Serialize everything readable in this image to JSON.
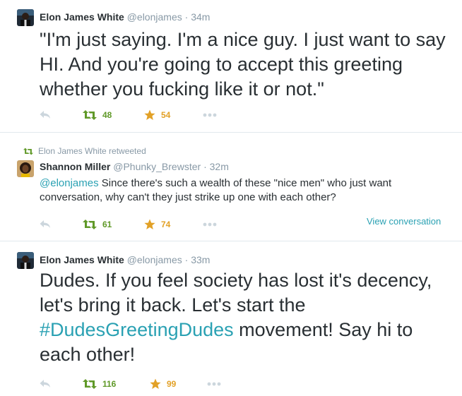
{
  "tweets": [
    {
      "name": "Elon James White",
      "handle": "@elonjames",
      "separator": "·",
      "time": "34m",
      "text": "\"I'm just saying. I'm a nice guy. I just want to say HI. And you're going to accept this greeting whether you fucking like it or not.\"",
      "retweets": "48",
      "favorites": "54"
    },
    {
      "context": "Elon James White retweeted",
      "name": "Shannon Miller",
      "handle": "@Phunky_Brewster",
      "separator": "·",
      "time": "32m",
      "mention": "@elonjames",
      "text": " Since there's such a wealth of these \"nice men\" who just want conversation, why can't they just strike up one with each other?",
      "retweets": "61",
      "favorites": "74",
      "view_conversation": "View conversation"
    },
    {
      "name": "Elon James White",
      "handle": "@elonjames",
      "separator": "·",
      "time": "33m",
      "text_before": "Dudes. If you feel society has lost it's decency, let's bring it back. Let's start the ",
      "hashtag": "#DudesGreetingDudes",
      "text_after": " movement! Say hi to each other!",
      "retweets": "116",
      "favorites": "99"
    }
  ],
  "colors": {
    "retweet": "#609928",
    "favorite": "#e2a127",
    "link": "#2aa1b3",
    "muted": "#8899a6",
    "action_icon": "#ccd6dd"
  },
  "icons": {
    "reply": "reply-icon",
    "retweet": "retweet-icon",
    "favorite": "star-icon",
    "more": "more-icon"
  }
}
